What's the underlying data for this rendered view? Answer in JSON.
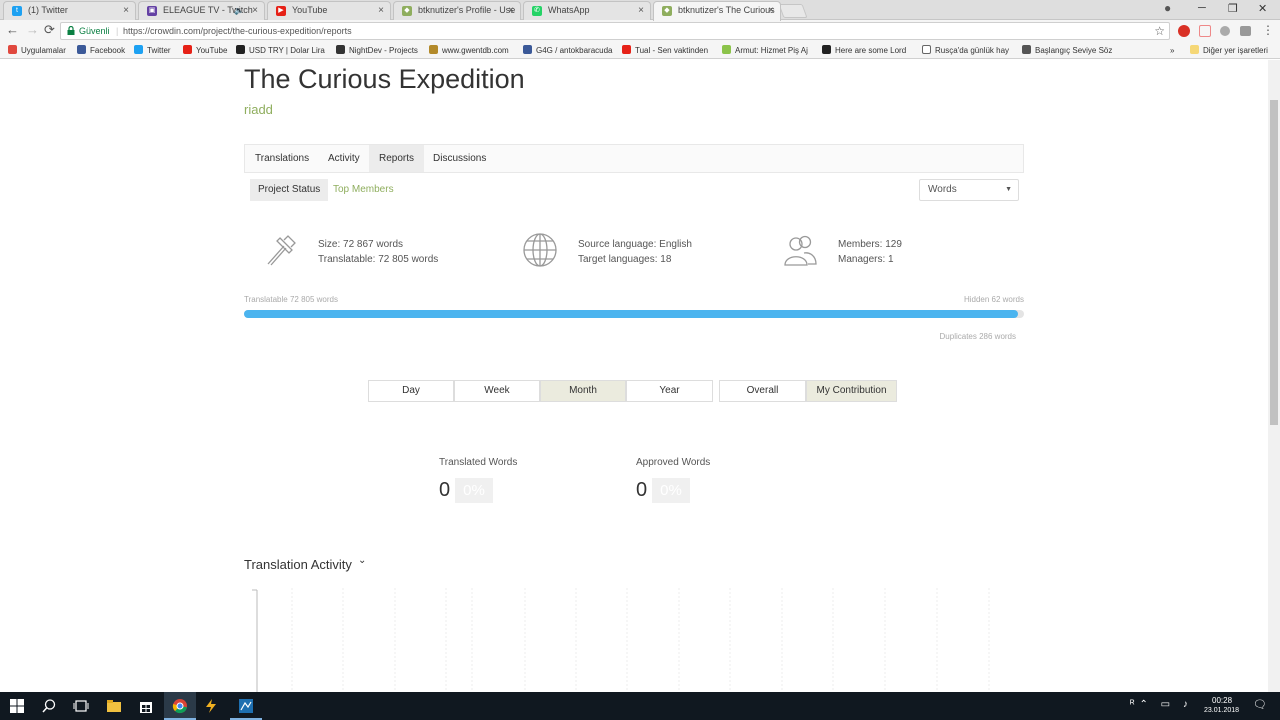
{
  "browser": {
    "tabs": [
      {
        "label": "(1) Twitter",
        "fav_color": "#1da1f2",
        "fav_glyph": "t"
      },
      {
        "label": "ELEAGUE TV - Twitch",
        "fav_color": "#6441a4",
        "fav_glyph": "▣",
        "sound": "🔈"
      },
      {
        "label": "YouTube",
        "fav_color": "#e62117",
        "fav_glyph": "▶"
      },
      {
        "label": "btknutizer's Profile - Use",
        "fav_color": "#8fae5e",
        "fav_glyph": "◆"
      },
      {
        "label": "WhatsApp",
        "fav_color": "#25d366",
        "fav_glyph": "✆"
      },
      {
        "label": "btknutizer's The Curious",
        "fav_color": "#8fae5e",
        "fav_glyph": "◆"
      }
    ],
    "close_glyph": "×",
    "window_controls": {
      "minimize": "─",
      "maximize": "❐",
      "close": "✕"
    },
    "account_icon": "●",
    "nav": {
      "back": "←",
      "forward": "→",
      "reload": "⟳"
    },
    "secure_label": "Güvenli",
    "url": "https://crowdin.com/project/the-curious-expedition/reports",
    "star": "☆",
    "bookmarks": [
      {
        "label": "Uygulamalar",
        "color": "#e0483e"
      },
      {
        "label": "Facebook",
        "color": "#3b5998"
      },
      {
        "label": "Twitter",
        "color": "#1da1f2"
      },
      {
        "label": "YouTube",
        "color": "#e62117"
      },
      {
        "label": "USD TRY | Dolar Lira",
        "color": "#222222"
      },
      {
        "label": "NightDev - Projects",
        "color": "#333333"
      },
      {
        "label": "www.gwentdb.com",
        "color": "#b38a2a"
      },
      {
        "label": "G4G / antokbaracuda",
        "color": "#3b5998"
      },
      {
        "label": "Tual - Sen vaktinden",
        "color": "#e62117"
      },
      {
        "label": "Armut: Hizmet Piş Aj",
        "color": "#8bc34a"
      },
      {
        "label": "Here are some Lord",
        "color": "#222222"
      },
      {
        "label": "Rusça'da günlük hay",
        "color": "#ffffff"
      },
      {
        "label": "Başlangıç Seviye Söz",
        "color": "#555555"
      }
    ],
    "bookmarks_more": "»",
    "other_bookmarks": "Diğer yer işaretleri"
  },
  "project": {
    "title": "The Curious Expedition",
    "owner": "riadd",
    "tabs": [
      "Translations",
      "Activity",
      "Reports",
      "Discussions"
    ],
    "active_tab": "Reports",
    "subtabs": [
      "Project Status",
      "Top Members"
    ],
    "unit_select": "Words",
    "select_arrow": "▼",
    "stats": {
      "size": "Size: 72 867 words",
      "translatable": "Translatable: 72 805 words",
      "source_language": "Source language: English",
      "target_languages": "Target languages: 18",
      "members": "Members: 129",
      "managers": "Managers: 1"
    },
    "progress": {
      "left_label": "Translatable 72 805 words",
      "right_label": "Hidden 62 words",
      "duplicates_label": "Duplicates 286 words",
      "fill_fraction": 0.992
    },
    "period_buttons": [
      "Day",
      "Week",
      "Month",
      "Year"
    ],
    "active_period": "Month",
    "scope_buttons": [
      "Overall",
      "My Contribution"
    ],
    "active_scope": "My Contribution",
    "metrics": [
      {
        "label": "Translated Words",
        "value": "0",
        "percent": "0%"
      },
      {
        "label": "Approved Words",
        "value": "0",
        "percent": "0%"
      }
    ],
    "activity_title": "Translation Activity",
    "activity_chevron": "⌄"
  },
  "taskbar": {
    "time": "00:28",
    "date": "23.01.2018",
    "tray_glyphs": "ᴿ⌃ ▭ ♪",
    "notification": "🗨"
  }
}
